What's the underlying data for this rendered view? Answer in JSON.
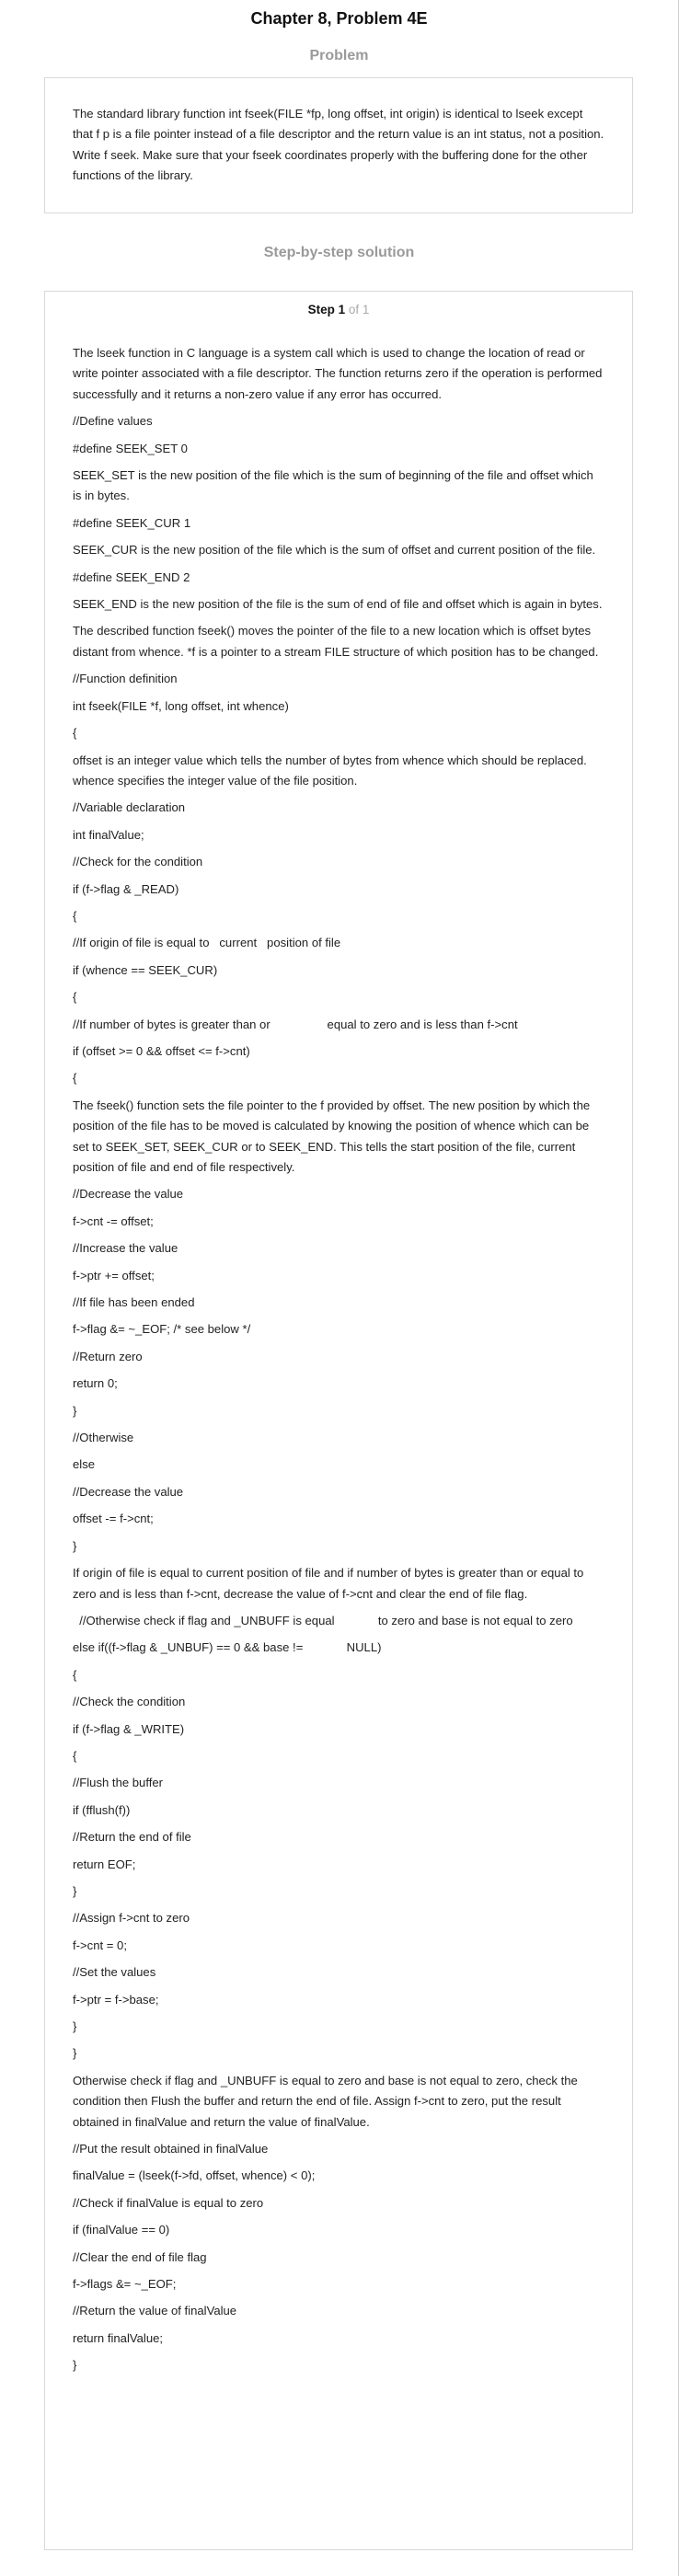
{
  "header": {
    "title": "Chapter 8, Problem 4E"
  },
  "problem": {
    "heading": "Problem",
    "text": "The standard library function int fseek(FILE *fp, long offset, int origin) is identical to lseek except that f p is a file pointer instead of a file descriptor and the return value is an int status, not a position. Write f seek. Make sure that your fseek coordinates properly with the buffering done for the other functions of the library."
  },
  "solution": {
    "heading": "Step-by-step solution",
    "step_label": "Step 1",
    "step_of": "of 1",
    "lines": [
      "The lseek function in C language is a system call which is used to change the location of read or write pointer associated with a file descriptor. The function returns zero if the operation is performed successfully and it returns a non-zero value if any error has occurred.",
      "//Define values",
      "#define SEEK_SET 0",
      "SEEK_SET is the new position of the file which is the sum of beginning of the file and offset which is in bytes.",
      "#define SEEK_CUR 1",
      "SEEK_CUR is the new position of the file which is the sum of offset and current position of the file.",
      "#define SEEK_END 2",
      "SEEK_END is the new position of the file is the sum of end of file and offset which is again in bytes.",
      "The described function fseek() moves the pointer of the file to a new location which is offset bytes distant from whence. *f is a pointer to a stream FILE structure of which position has to be changed.",
      "//Function definition",
      "int fseek(FILE *f, long offset, int whence)",
      "{",
      "offset is an integer value which tells the number of bytes from whence which should be replaced. whence specifies the integer value of the file position.",
      "//Variable declaration",
      "int finalValue;",
      "//Check for the condition",
      "if (f->flag & _READ)",
      "{",
      "//If origin of file is equal to   current   position of file",
      "if (whence == SEEK_CUR)",
      "{",
      "//If number of bytes is greater than or                 equal to zero and is less than f->cnt",
      "if (offset >= 0 && offset <= f->cnt)",
      "{",
      "The fseek() function sets the file pointer to the f provided by offset. The new position by which the position of the file has to be moved is calculated by knowing the position of whence which can be set to SEEK_SET, SEEK_CUR or to SEEK_END. This tells the start position of the file, current position of file and end of file respectively.",
      "//Decrease the value",
      "f->cnt -= offset;",
      "//Increase the value",
      "f->ptr += offset;",
      "//If file has been ended",
      "f->flag &= ~_EOF; /* see below */",
      "//Return zero",
      "return 0;",
      "}",
      "//Otherwise",
      "else",
      "//Decrease the value",
      "offset -= f->cnt;",
      "}",
      "If origin of file is equal to current position of file and if number of bytes is greater than or equal to zero and is less than f->cnt, decrease the value of f->cnt and clear the end of file flag.",
      "  //Otherwise check if flag and _UNBUFF is equal             to zero and base is not equal to zero",
      "else if((f->flag & _UNBUF) == 0 && base !=             NULL)",
      "{",
      "//Check the condition",
      "if (f->flag & _WRITE)",
      "{",
      "//Flush the buffer",
      "if (fflush(f))",
      "//Return the end of file",
      "return EOF;",
      "}",
      "//Assign f->cnt to zero",
      "f->cnt = 0;",
      "//Set the values",
      "f->ptr = f->base;",
      "}",
      "}",
      "Otherwise check if flag and _UNBUFF is equal to zero and base is not equal to zero, check the condition then Flush the buffer and return the end of file. Assign f->cnt to zero, put the result obtained in finalValue and return the value of finalValue.",
      "//Put the result obtained in finalValue",
      "finalValue = (lseek(f->fd, offset, whence) < 0);",
      "//Check if finalValue is equal to zero",
      "if (finalValue == 0)",
      "//Clear the end of file flag",
      "f->flags &= ~_EOF;",
      "//Return the value of finalValue",
      "return finalValue;",
      "}"
    ]
  }
}
